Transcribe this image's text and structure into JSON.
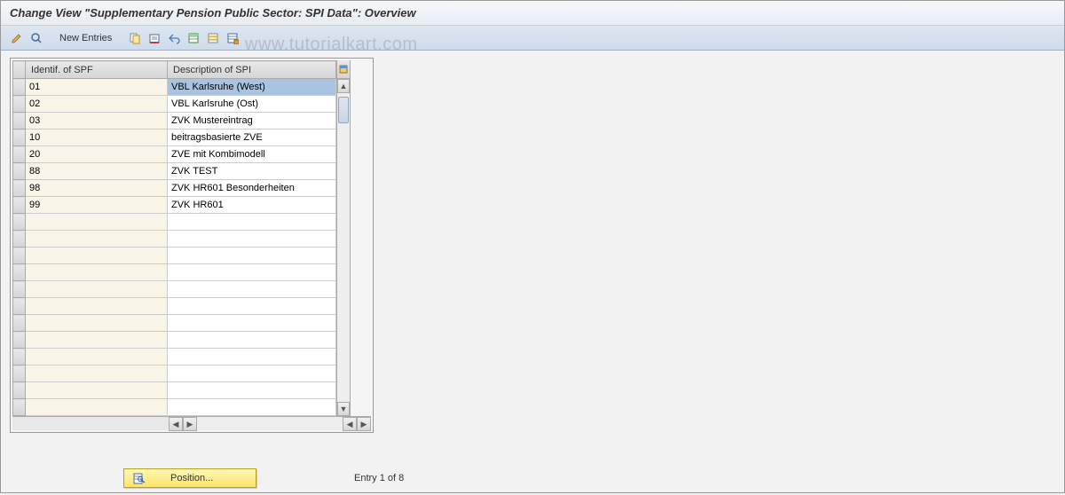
{
  "title": "Change View \"Supplementary Pension Public Sector: SPI Data\": Overview",
  "watermark": "www.tutorialkart.com",
  "toolbar": {
    "new_entries_label": "New Entries"
  },
  "table": {
    "columns": {
      "identif": "Identif. of SPF",
      "desc": "Description of SPI"
    },
    "rows": [
      {
        "id": "01",
        "desc": "VBL Karlsruhe (West)",
        "selected": true
      },
      {
        "id": "02",
        "desc": "VBL Karlsruhe (Ost)"
      },
      {
        "id": "03",
        "desc": "ZVK Mustereintrag"
      },
      {
        "id": "10",
        "desc": "beitragsbasierte ZVE"
      },
      {
        "id": "20",
        "desc": "ZVE mit Kombimodell"
      },
      {
        "id": "88",
        "desc": "ZVK TEST"
      },
      {
        "id": "98",
        "desc": "ZVK HR601 Besonderheiten"
      },
      {
        "id": "99",
        "desc": "ZVK HR601"
      }
    ],
    "empty_rows": 12
  },
  "footer": {
    "position_label": "Position...",
    "entry_text": "Entry 1 of 8"
  }
}
